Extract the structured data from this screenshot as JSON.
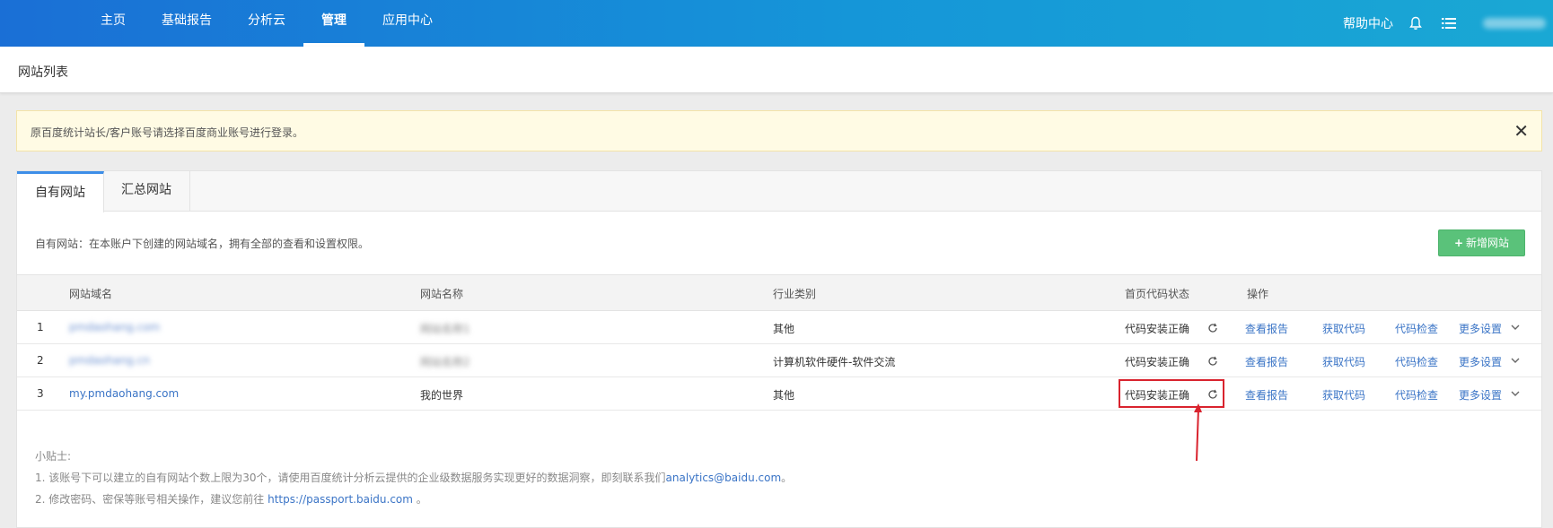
{
  "nav": {
    "items": [
      "主页",
      "基础报告",
      "分析云",
      "管理",
      "应用中心"
    ],
    "active": "管理",
    "help": "帮助中心"
  },
  "page": {
    "title": "网站列表"
  },
  "notice": {
    "text": "原百度统计站长/客户账号请选择百度商业账号进行登录。",
    "close": "✕"
  },
  "tabs": {
    "own": "自有网站",
    "summary": "汇总网站"
  },
  "desc": "自有网站：在本账户下创建的网站域名，拥有全部的查看和设置权限。",
  "add_button": "新增网站",
  "table": {
    "headers": {
      "domain": "网站域名",
      "name": "网站名称",
      "industry": "行业类别",
      "status": "首页代码状态",
      "ops": "操作"
    },
    "rows": [
      {
        "index": "1",
        "domain": "pmdaohang.com",
        "name": "网站名称1",
        "industry": "其他",
        "status": "代码安装正确"
      },
      {
        "index": "2",
        "domain": "pmdaohang.cn",
        "name": "网站名称2",
        "industry": "计算机软件硬件-软件交流",
        "status": "代码安装正确"
      },
      {
        "index": "3",
        "domain": "my.pmdaohang.com",
        "name": "我的世界",
        "industry": "其他",
        "status": "代码安装正确"
      }
    ],
    "actions": {
      "report": "查看报告",
      "code": "获取代码",
      "check": "代码检查",
      "more": "更多设置"
    }
  },
  "tips": {
    "title": "小贴士:",
    "line1_prefix": "1. 该账号下可以建立的自有网站个数上限为30个，请使用百度统计分析云提供的企业级数据服务实现更好的数据洞察，即刻联系我们",
    "line1_email": "analytics@baidu.com",
    "line1_suffix": "。",
    "line2_prefix": "2. 修改密码、密保等账号相关操作，建议您前往 ",
    "line2_link": "https://passport.baidu.com",
    "line2_suffix": " 。"
  }
}
